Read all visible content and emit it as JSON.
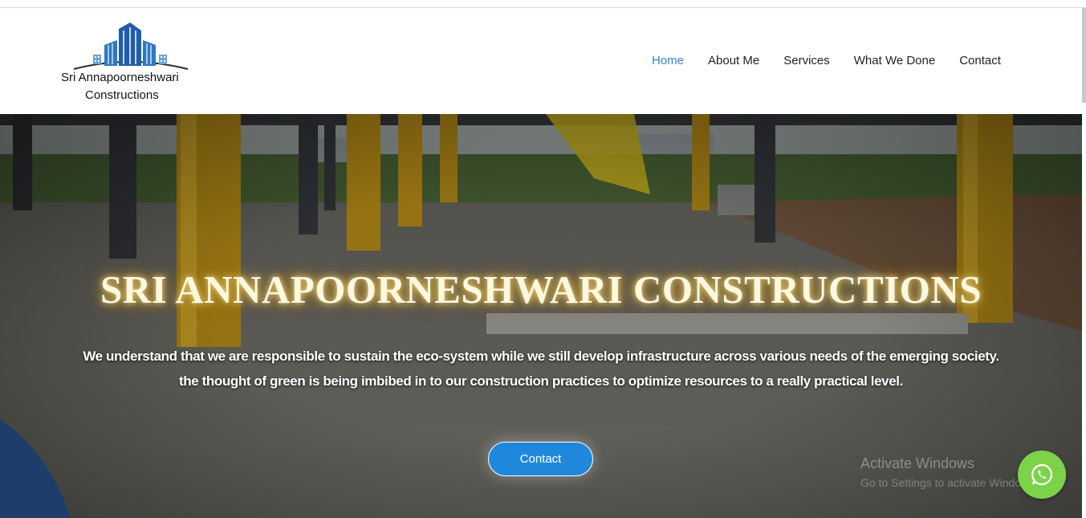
{
  "brand": {
    "line1": "Sri Annapoorneshwari",
    "line2": "Constructions"
  },
  "nav": {
    "items": [
      {
        "label": "Home",
        "active": true
      },
      {
        "label": "About Me",
        "active": false
      },
      {
        "label": "Services",
        "active": false
      },
      {
        "label": "What We Done",
        "active": false
      },
      {
        "label": "Contact",
        "active": false
      }
    ]
  },
  "hero": {
    "title": "SRI ANNAPOORNESHWARI CONSTRUCTIONS",
    "description": "We understand that we are responsible to sustain the eco-system while we still develop infrastructure across various needs of the emerging society. the thought of green is being imbibed in to our construction practices to optimize resources to a really practical level.",
    "button_label": "Contact"
  },
  "watermark": {
    "line1": "Activate Windows",
    "line2": "Go to Settings to activate Windows."
  },
  "floating": {
    "icon": "whatsapp-icon"
  },
  "colors": {
    "accent": "#3a85c7",
    "button": "#1f88dc",
    "whatsapp": "#7cd34a"
  }
}
